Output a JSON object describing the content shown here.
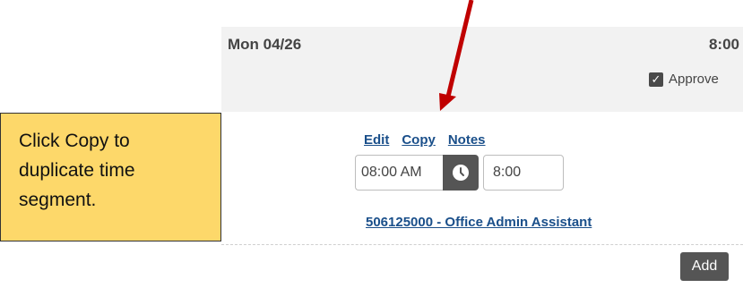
{
  "day": {
    "label": "Mon 04/26",
    "hours": "8:00"
  },
  "approve": {
    "label": "Approve",
    "checked": true
  },
  "segment": {
    "links": [
      "Edit",
      "Copy",
      "Notes"
    ],
    "start_time": "08:00 AM",
    "duration": "8:00",
    "job": "506125000 - Office Admin Assistant"
  },
  "add_label": "Add",
  "callout": {
    "text": "Click Copy to duplicate time segment."
  },
  "colors": {
    "arrow": "#c00000",
    "callout_bg": "#fdd86a",
    "link": "#1a4f8a"
  }
}
